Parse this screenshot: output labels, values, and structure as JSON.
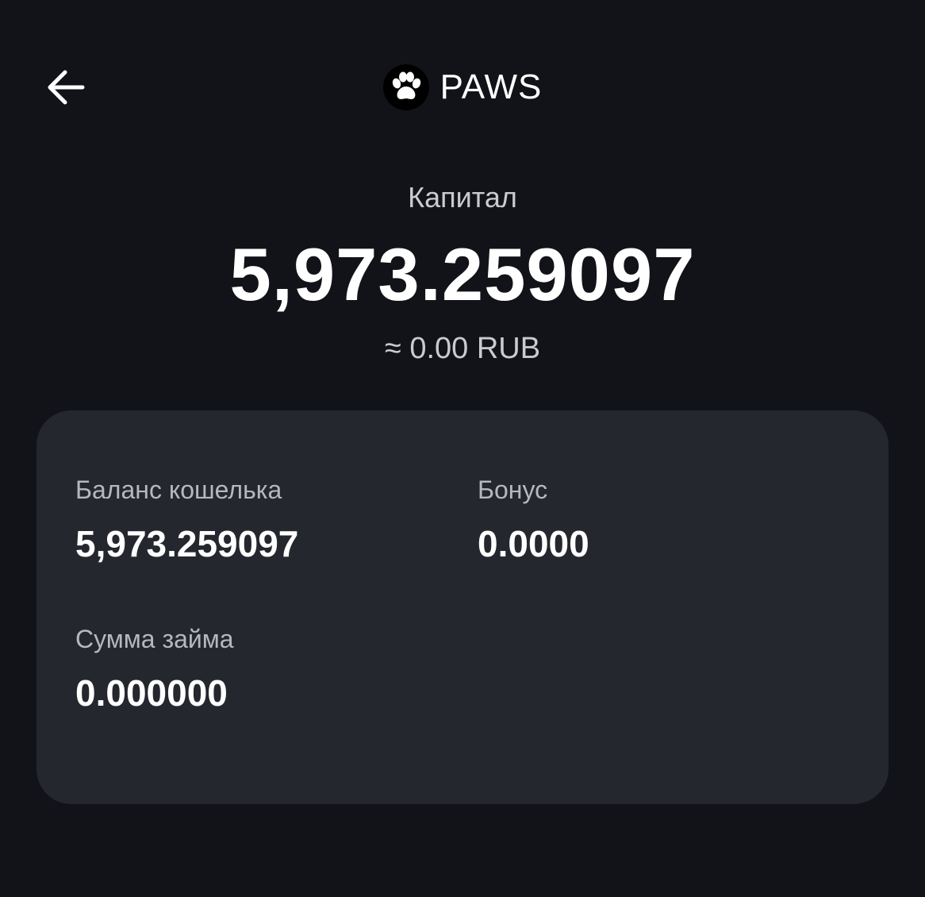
{
  "header": {
    "back_icon": "arrow-left-icon",
    "token_logo_icon": "paw-icon",
    "token_name": "PAWS"
  },
  "capital": {
    "label": "Капитал",
    "value": "5,973.259097",
    "fiat_equivalent": "≈ 0.00 RUB"
  },
  "details": {
    "wallet_balance": {
      "label": "Баланс кошелька",
      "value": "5,973.259097"
    },
    "bonus": {
      "label": "Бонус",
      "value": "0.0000"
    },
    "loan_amount": {
      "label": "Сумма займа",
      "value": "0.000000"
    }
  },
  "colors": {
    "background": "#121318",
    "card": "#25272e",
    "text_primary": "#ffffff",
    "text_secondary": "#c9cbd1"
  }
}
